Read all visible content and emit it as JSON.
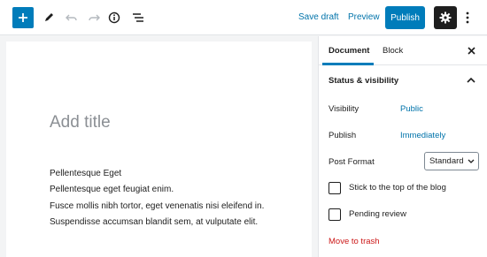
{
  "toolbar": {
    "add_icon": "plus-icon",
    "tools_icon": "pencil-icon",
    "undo_icon": "undo-icon",
    "redo_icon": "redo-icon",
    "info_icon": "info-icon",
    "outline_icon": "list-outline-icon",
    "save_draft": "Save draft",
    "preview": "Preview",
    "publish": "Publish",
    "settings_icon": "gear-icon",
    "more_icon": "more-vertical-icon",
    "accent": "#007cba"
  },
  "editor": {
    "title_placeholder": "Add title",
    "paragraphs": [
      "Pellentesque Eget",
      "Pellentesque eget feugiat enim.",
      "Fusce mollis nibh tortor, eget venenatis nisi eleifend in.",
      "Suspendisse accumsan blandit sem, at vulputate elit."
    ]
  },
  "sidebar": {
    "tabs": [
      "Document",
      "Block"
    ],
    "active_tab": "Document",
    "close_icon": "close-icon",
    "panel_title": "Status & visibility",
    "visibility_label": "Visibility",
    "visibility_value": "Public",
    "publish_label": "Publish",
    "publish_value": "Immediately",
    "post_format_label": "Post Format",
    "post_format_value": "Standard",
    "stick_label": "Stick to the top of the blog",
    "pending_label": "Pending review",
    "trash_label": "Move to trash",
    "trash_color": "#cc1818"
  }
}
